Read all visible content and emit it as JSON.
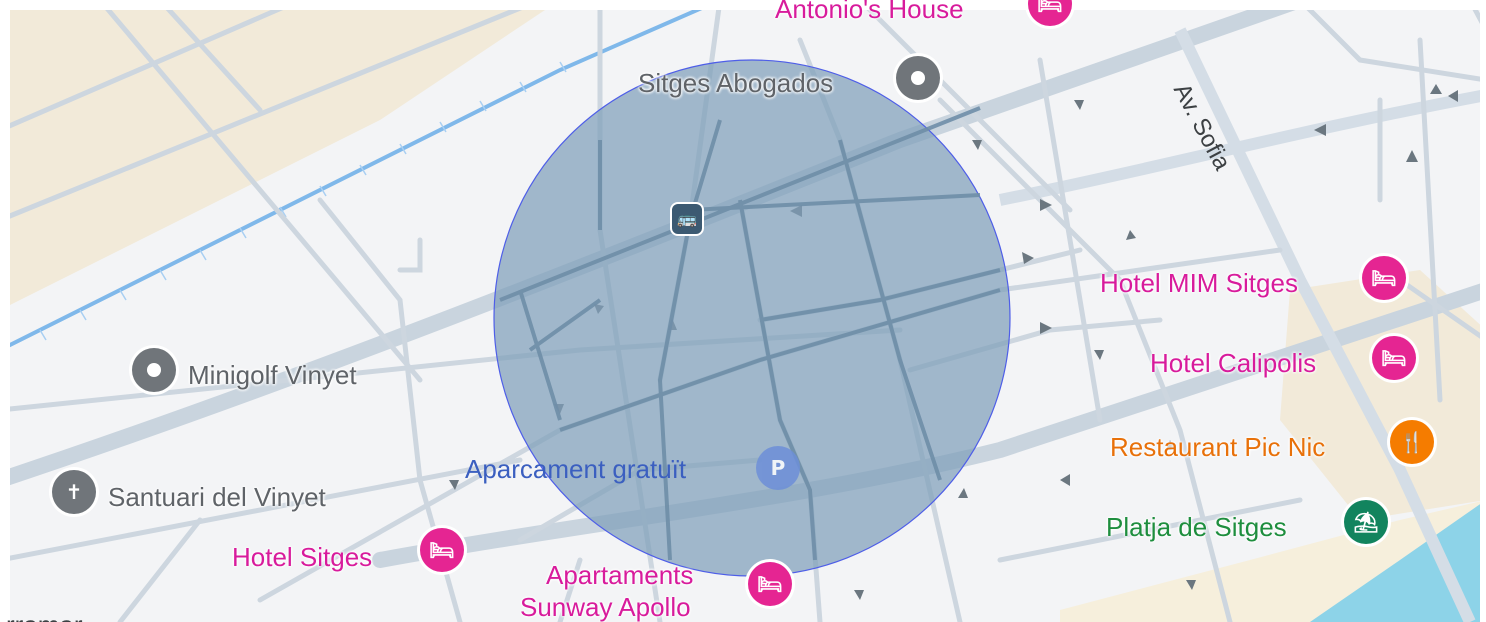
{
  "map": {
    "colors": {
      "land": "#f3f4f6",
      "street": "#c8d2dc",
      "main_road": "#bccbd8",
      "sand": "#f2ead9",
      "water": "#8dd3e8",
      "rail": "#7fb8ea",
      "radius_fill": "#7f9fba",
      "radius_stroke": "#4e5ee8"
    },
    "radius_circle": {
      "shape": "circle",
      "fill_opacity": 0.72
    },
    "streets": [
      {
        "name": "Av. Sofia"
      }
    ],
    "places": [
      {
        "id": "antonios-house",
        "name": "Antonio's House",
        "type": "hotel",
        "color": "pink",
        "icon": "hotel-icon"
      },
      {
        "id": "sitges-abogados",
        "name": "Sitges Abogados",
        "type": "poi",
        "color": "gray",
        "icon": "place-dot-icon"
      },
      {
        "id": "hotel-mim",
        "name": "Hotel MIM Sitges",
        "type": "hotel",
        "color": "pink",
        "icon": "hotel-icon"
      },
      {
        "id": "hotel-calipolis",
        "name": "Hotel Calipolis",
        "type": "hotel",
        "color": "pink",
        "icon": "hotel-icon"
      },
      {
        "id": "pic-nic",
        "name": "Restaurant Pic Nic",
        "type": "restaurant",
        "color": "orange",
        "icon": "restaurant-icon"
      },
      {
        "id": "platja",
        "name": "Platja de Sitges",
        "type": "beach",
        "color": "green",
        "icon": "beach-icon"
      },
      {
        "id": "minigolf",
        "name": "Minigolf Vinyet",
        "type": "poi",
        "color": "gray",
        "icon": "place-dot-icon"
      },
      {
        "id": "santuari",
        "name": "Santuari del Vinyet",
        "type": "church",
        "color": "gray",
        "icon": "cross-icon"
      },
      {
        "id": "hotel-sitges",
        "name": "Hotel Sitges",
        "type": "hotel",
        "color": "pink",
        "icon": "hotel-icon"
      },
      {
        "id": "aparcament",
        "name": "Aparcament gratuït",
        "type": "parking",
        "color": "blue",
        "icon": "parking-icon",
        "glyph": "P"
      },
      {
        "id": "sunway",
        "name_line1": "Apartaments",
        "name_line2": "Sunway Apollo",
        "type": "hotel",
        "color": "pink",
        "icon": "hotel-icon"
      },
      {
        "id": "bottom-left",
        "name": "rramar",
        "type": "poi",
        "color": "dark"
      }
    ],
    "transit": [
      {
        "id": "bus-stop",
        "icon": "bus-stop-icon"
      }
    ]
  }
}
